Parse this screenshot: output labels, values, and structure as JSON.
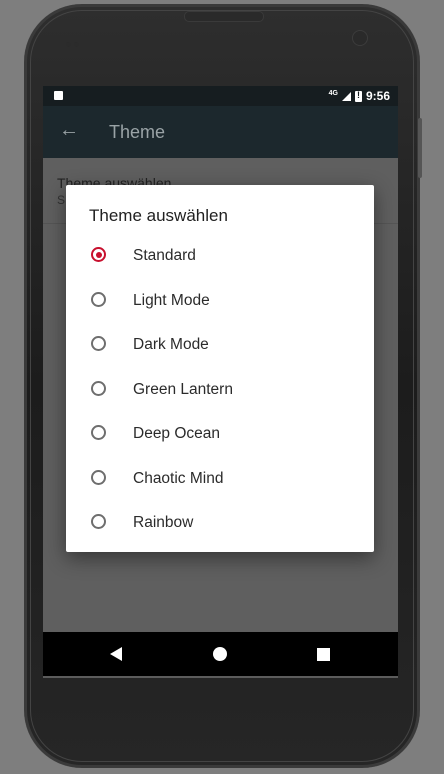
{
  "status_bar": {
    "network": "4G",
    "time": "9:56"
  },
  "app_bar": {
    "back_icon": "arrow-left-icon",
    "title": "Theme"
  },
  "preference": {
    "title": "Theme auswählen",
    "summary": "S"
  },
  "dialog": {
    "title": "Theme auswählen",
    "selected_index": 0,
    "accent_color": "#c8102e",
    "options": [
      {
        "label": "Standard",
        "selected": true
      },
      {
        "label": "Light Mode",
        "selected": false
      },
      {
        "label": "Dark Mode",
        "selected": false
      },
      {
        "label": "Green Lantern",
        "selected": false
      },
      {
        "label": "Deep Ocean",
        "selected": false
      },
      {
        "label": "Chaotic Mind",
        "selected": false
      },
      {
        "label": "Rainbow",
        "selected": false
      }
    ]
  },
  "nav_bar": {
    "back": "triangle-back-icon",
    "home": "circle-home-icon",
    "recents": "square-recents-icon"
  }
}
